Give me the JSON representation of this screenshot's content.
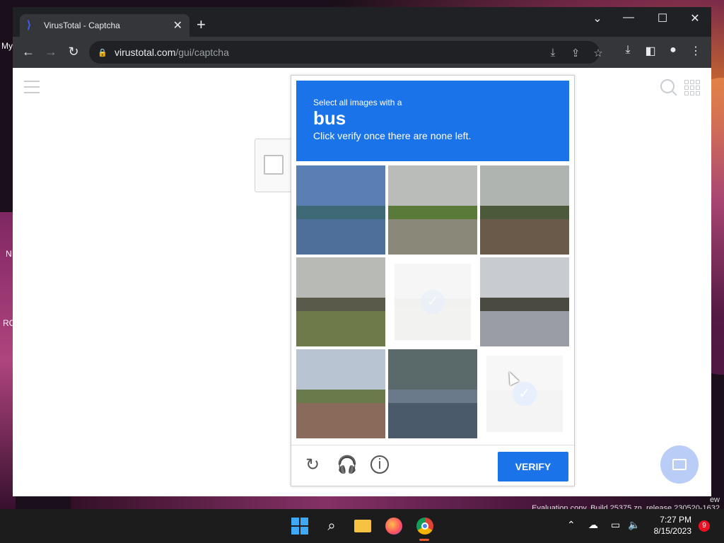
{
  "browser": {
    "tab_title": "VirusTotal - Captcha",
    "tab_close": "✕",
    "new_tab": "+",
    "url_host": "virustotal.com",
    "url_path": "/gui/captcha"
  },
  "captcha": {
    "prompt_line1": "Select all images with a",
    "target_word": "bus",
    "prompt_line3": "Click verify once there are none left.",
    "verify_label": "VERIFY",
    "accent_color": "#1a73e8",
    "tiles": [
      {
        "index": 0,
        "selected": false
      },
      {
        "index": 1,
        "selected": false
      },
      {
        "index": 2,
        "selected": false
      },
      {
        "index": 3,
        "selected": false
      },
      {
        "index": 4,
        "selected": true
      },
      {
        "index": 5,
        "selected": false
      },
      {
        "index": 6,
        "selected": false
      },
      {
        "index": 7,
        "selected": false
      },
      {
        "index": 8,
        "selected": true
      }
    ]
  },
  "desktop": {
    "label_my": "My",
    "label_n": "N",
    "label_rc": "RC",
    "eval_line1": "ew",
    "eval_line2": "Evaluation copy. Build 25375.zn_release.230520-1632"
  },
  "taskbar": {
    "time": "7:27 PM",
    "date": "8/15/2023",
    "notification_count": "9"
  }
}
